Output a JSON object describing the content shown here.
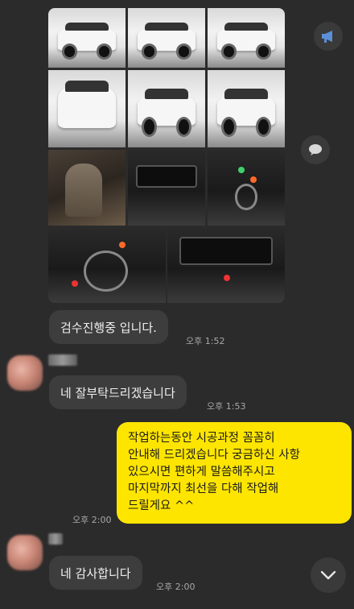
{
  "chat": {
    "messages": [
      {
        "sender": "other",
        "text": "검수진행중 입니다.",
        "time": "오후 1:52"
      },
      {
        "sender": "other",
        "text": "네 잘부탁드리겠습니다",
        "time": "오후 1:53"
      },
      {
        "sender": "me",
        "lines": [
          "작업하는동안 시공과정 꼼꼼히",
          "안내해 드리겠습니다 궁금하신 사항",
          "있으시면 편하게 말씀해주시고",
          "마지막까지 최선을 다해 작업해",
          "드릴게요 ^^"
        ],
        "time": "오후 2:00"
      },
      {
        "sender": "other",
        "text": "네 감사합니다",
        "time": "오후 2:00"
      }
    ]
  },
  "icons": {
    "announce": "megaphone-icon",
    "share": "speech-bubble-icon",
    "scroll_down": "chevron-down-icon"
  },
  "colors": {
    "background": "#2b2b2b",
    "my_bubble": "#fee500",
    "other_bubble": "#3d3d3d",
    "accent_icon": "#5b8fd6"
  }
}
